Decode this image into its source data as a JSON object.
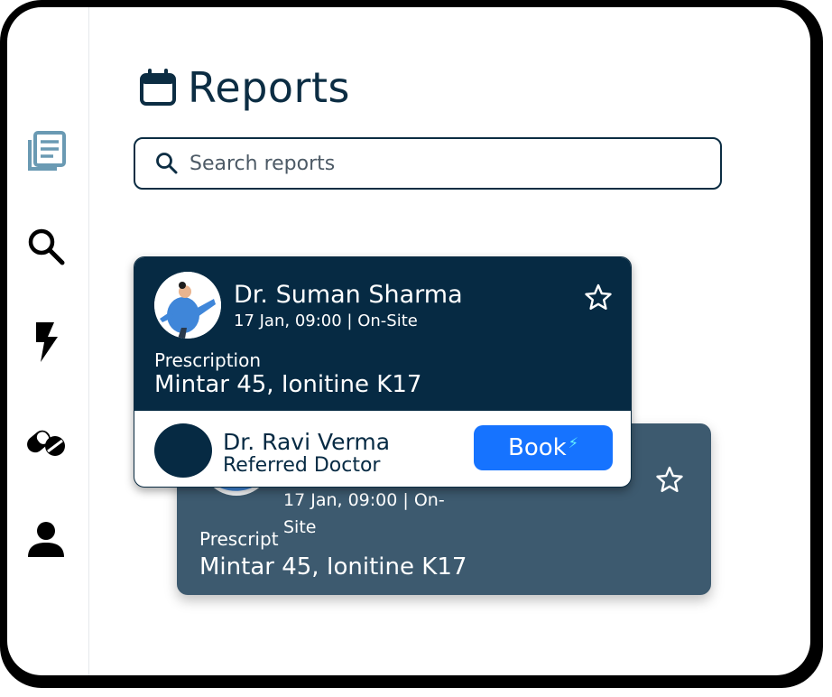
{
  "header": {
    "title": "Reports"
  },
  "search": {
    "placeholder": "Search reports"
  },
  "sidebar": {
    "items": [
      {
        "icon": "reports-icon",
        "active": true
      },
      {
        "icon": "search-icon",
        "active": false
      },
      {
        "icon": "lightning-icon",
        "active": false
      },
      {
        "icon": "pills-icon",
        "active": false
      },
      {
        "icon": "profile-icon",
        "active": false
      }
    ]
  },
  "cards": {
    "front": {
      "doctor_name": "Dr. Suman Sharma",
      "meta": "17 Jan, 09:00 | On-Site",
      "label": "Prescription",
      "value": "Mintar 45, Ionitine K17",
      "referred_name": "Dr. Ravi Verma",
      "referred_role": "Referred Doctor",
      "book_label": "Book"
    },
    "back": {
      "meta_line1": "17 Jan, 09:00 | On-",
      "meta_line2": "Site",
      "label": "Prescript",
      "value": "Mintar 45, Ionitine K17"
    }
  },
  "colors": {
    "navy": "#062a43",
    "slate": "#3d5a6f",
    "accent": "#1673ff",
    "active_icon": "#6a9ab3"
  }
}
